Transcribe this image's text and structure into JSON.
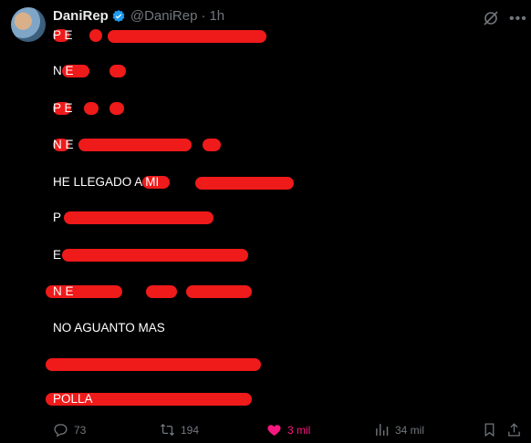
{
  "post": {
    "author_name": "DaniRep",
    "handle": "@DaniRep",
    "separator": "·",
    "time": "1h",
    "lines": [
      {
        "text": "P        E"
      },
      {
        "text": "N        E"
      },
      {
        "text": "P    E"
      },
      {
        "text": "N                              E"
      },
      {
        "text": "HE LLEGADO A      MI"
      },
      {
        "text": "P"
      },
      {
        "text": "E"
      },
      {
        "text": "                 N           E"
      },
      {
        "text": "NO AGUANTO MAS"
      },
      {
        "text": ""
      },
      {
        "text": "                                                      POLLA"
      }
    ]
  },
  "actions": {
    "replies": "73",
    "reposts": "194",
    "likes": "3 mil",
    "views": "34 mil"
  },
  "colors": {
    "accent_like": "#f91880",
    "verified": "#1d9bf0",
    "redaction": "#ef1a1a"
  },
  "icons": [
    "verified-badge-icon",
    "grok-icon",
    "more-icon",
    "reply-icon",
    "repost-icon",
    "heart-icon",
    "views-icon",
    "bookmark-icon",
    "share-icon"
  ]
}
